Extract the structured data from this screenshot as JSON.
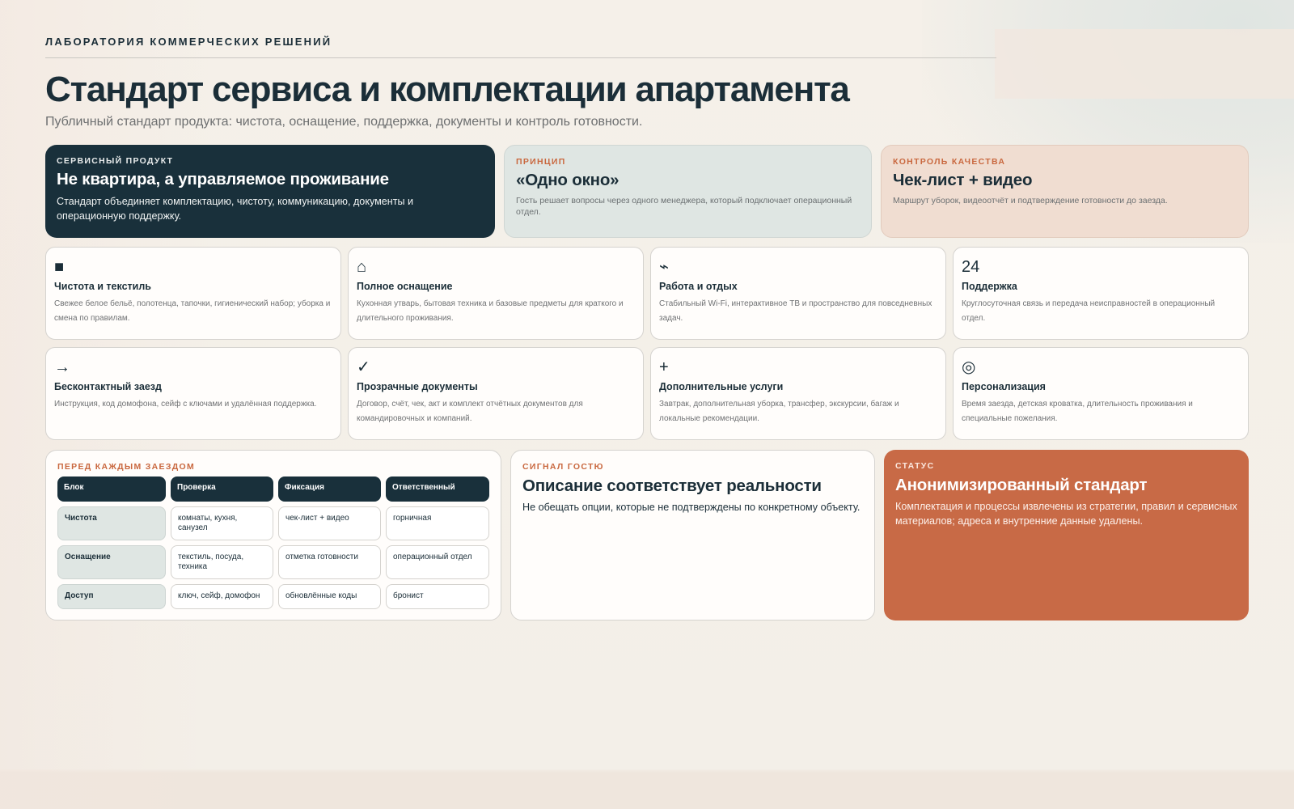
{
  "header": {
    "eyebrow": "ЛАБОРАТОРИЯ КОММЕРЧЕСКИХ РЕШЕНИЙ",
    "title": "Стандарт сервиса и комплектации апартамента",
    "subtitle": "Публичный стандарт продукта: чистота, оснащение, поддержка, документы и контроль готовности."
  },
  "top_cards": [
    {
      "kicker": "СЕРВИСНЫЙ ПРОДУКТ",
      "title": "Не квартира, а управляемое проживание",
      "text": "Стандарт объединяет комплектацию, чистоту, коммуникацию, документы и операционную поддержку."
    },
    {
      "kicker": "ПРИНЦИП",
      "title": "«Одно окно»",
      "text": "Гость решает вопросы через одного менеджера, который подключает операционный отдел."
    },
    {
      "kicker": "КОНТРОЛЬ КАЧЕСТВА",
      "title": "Чек-лист + видео",
      "text": "Маршрут уборок, видеоотчёт и подтверждение готовности до заезда."
    }
  ],
  "features": [
    {
      "icon": "square-icon",
      "glyph": "■",
      "title": "Чистота и текстиль",
      "text": "Свежее белое бельё, полотенца, тапочки, гигиенический набор; уборка и смена по правилам."
    },
    {
      "icon": "house-icon",
      "glyph": "⌂",
      "title": "Полное оснащение",
      "text": "Кухонная утварь, бытовая техника и базовые предметы для краткого и длительного проживания."
    },
    {
      "icon": "signal-icon",
      "glyph": "⌁",
      "title": "Работа и отдых",
      "text": "Стабильный Wi-Fi, интерактивное ТВ и пространство для повседневных задач."
    },
    {
      "icon": "24-icon",
      "glyph": "24",
      "title": "Поддержка",
      "text": "Круглосуточная связь и передача неисправностей в операционный отдел."
    },
    {
      "icon": "arrow-right-icon",
      "glyph": "→",
      "title": "Бесконтактный заезд",
      "text": "Инструкция, код домофона, сейф с ключами и удалённая поддержка."
    },
    {
      "icon": "checkmark-icon",
      "glyph": "✓",
      "title": "Прозрачные документы",
      "text": "Договор, счёт, чек, акт и комплект отчётных документов для командировочных и компаний."
    },
    {
      "icon": "plus-icon",
      "glyph": "+",
      "title": "Дополнительные услуги",
      "text": "Завтрак, дополнительная уборка, трансфер, экскурсии, багаж и локальные рекомендации."
    },
    {
      "icon": "target-icon",
      "glyph": "◎",
      "title": "Персонализация",
      "text": "Время заезда, детская кроватка, длительность проживания и специальные пожелания."
    }
  ],
  "checklist": {
    "kicker": "ПЕРЕД КАЖДЫМ ЗАЕЗДОМ",
    "headers": [
      "Блок",
      "Проверка",
      "Фиксация",
      "Ответственный"
    ],
    "rows": [
      [
        "Чистота",
        "комнаты, кухня, санузел",
        "чек-лист + видео",
        "горничная"
      ],
      [
        "Оснащение",
        "текстиль, посуда, техника",
        "отметка готовности",
        "операционный отдел"
      ],
      [
        "Доступ",
        "ключ, сейф, домофон",
        "обновлённые коды",
        "бронист"
      ]
    ]
  },
  "signal": {
    "kicker": "СИГНАЛ ГОСТЮ",
    "title": "Описание соответствует реальности",
    "text": "Не обещать опции, которые не подтверждены по конкретному объекту."
  },
  "status": {
    "kicker": "СТАТУС",
    "title": "Анонимизированный стандарт",
    "text": "Комплектация и процессы извлечены из стратегии, правил и сервисных материалов; адреса и внутренние данные удалены."
  }
}
